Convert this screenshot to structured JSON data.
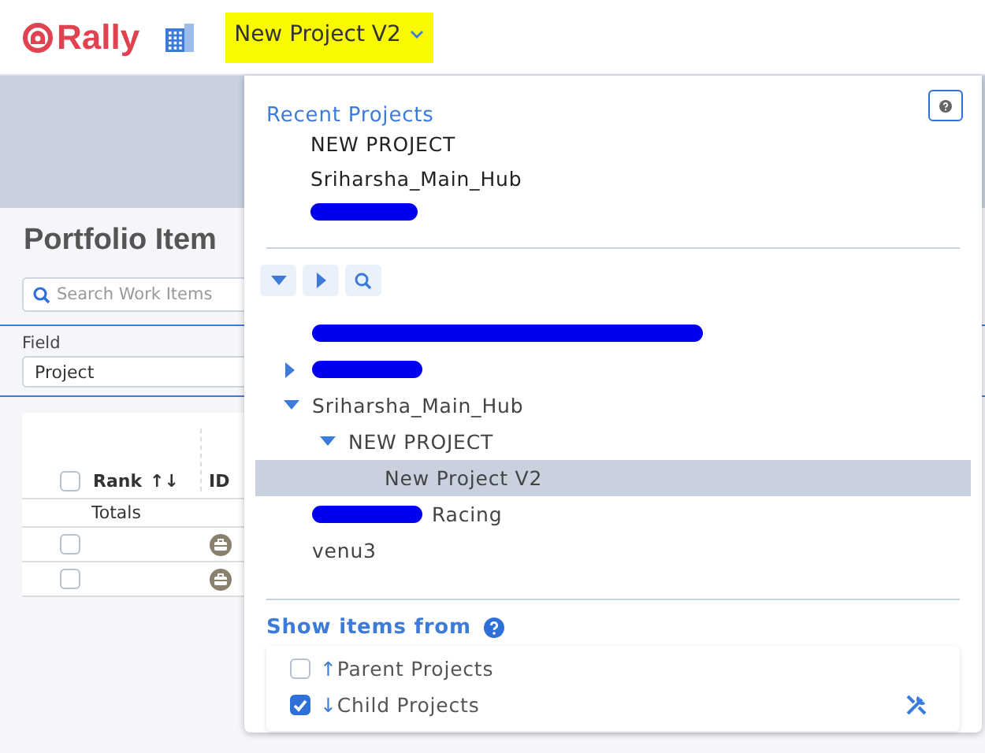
{
  "header": {
    "logo": "Rally",
    "project": "New Project V2",
    "highlighted": true
  },
  "page": {
    "title": "Portfolio Item",
    "search": {
      "placeholder": "Search Work Items"
    },
    "field_label": "Field",
    "field_value": "Project",
    "table": {
      "select_all_checked": false,
      "columns": [
        {
          "label": "Rank",
          "sort": "↑↓"
        },
        {
          "label": "ID"
        }
      ],
      "totals": "Totals",
      "rows": [
        {
          "checked": false
        },
        {
          "checked": false
        }
      ]
    }
  },
  "dropdown": {
    "recent_title": "Recent Projects",
    "recent": [
      {
        "label": "NEW PROJECT"
      },
      {
        "label": "Sriharsha_Main_Hub"
      },
      {
        "redacted": true
      }
    ],
    "tree": [
      {
        "redacted": true,
        "selected": false
      },
      {
        "redacted": true,
        "expanded": false,
        "selected": false
      },
      {
        "label": "Sriharsha_Main_Hub",
        "expanded": true,
        "selected": false,
        "children": [
          {
            "label": "NEW PROJECT",
            "expanded": true,
            "selected": false,
            "children": [
              {
                "label": "New Project V2",
                "selected": true
              }
            ]
          }
        ]
      },
      {
        "redacted": true,
        "label": "Racing",
        "selected": false
      },
      {
        "label": "venu3",
        "selected": false
      }
    ],
    "show_title": "Show items from",
    "options": [
      {
        "arrow": "↑",
        "label": "Parent Projects",
        "checked": false
      },
      {
        "arrow": "↓",
        "label": "Child Projects",
        "checked": true
      }
    ]
  }
}
